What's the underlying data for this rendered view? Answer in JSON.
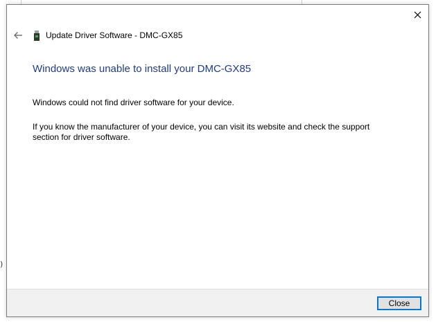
{
  "dialog": {
    "header_title": "Update Driver Software - DMC-GX85",
    "heading": "Windows was unable to install your DMC-GX85",
    "message_1": "Windows could not find driver software for your device.",
    "message_2": "If you know the manufacturer of your device, you can visit its website and check the support section for driver software.",
    "close_button_label": "Close"
  },
  "background": {
    "edge_mark": ")"
  },
  "icons": {
    "close": "close-icon",
    "back": "back-arrow-icon",
    "device": "usb-device-icon"
  },
  "colors": {
    "heading": "#1f3b8a",
    "focus_border": "#0078d7",
    "footer": "#f0f0f0"
  }
}
